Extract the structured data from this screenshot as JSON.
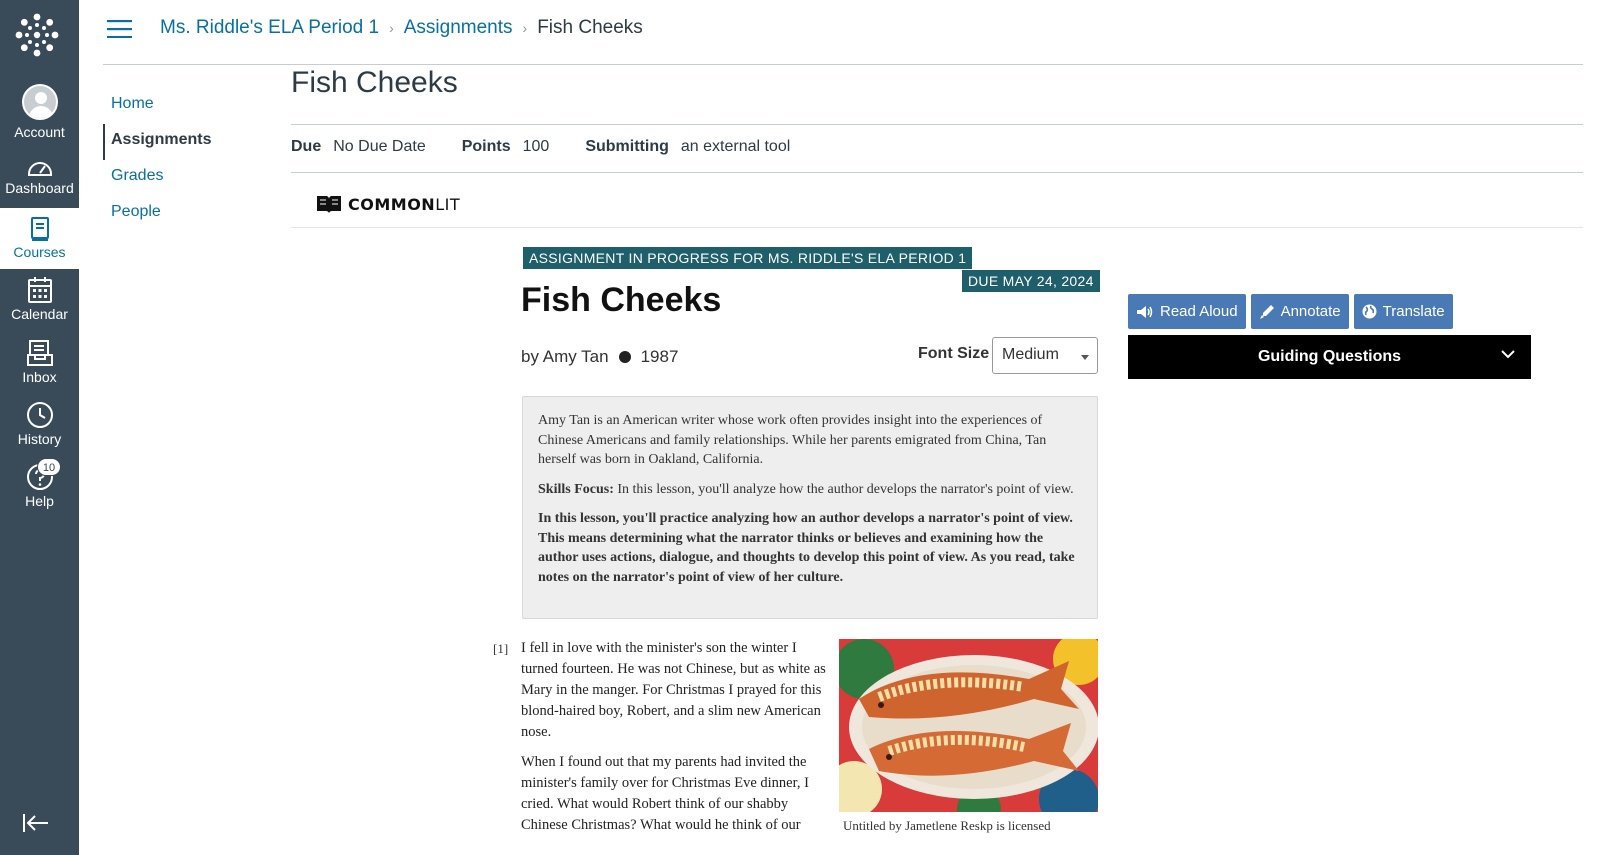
{
  "global_nav": {
    "items": [
      {
        "label": "Account",
        "icon": "account-avatar"
      },
      {
        "label": "Dashboard",
        "icon": "dashboard-icon"
      },
      {
        "label": "Courses",
        "icon": "courses-icon"
      },
      {
        "label": "Calendar",
        "icon": "calendar-icon"
      },
      {
        "label": "Inbox",
        "icon": "inbox-icon"
      },
      {
        "label": "History",
        "icon": "history-icon"
      },
      {
        "label": "Help",
        "icon": "help-icon"
      }
    ],
    "help_badge": "10"
  },
  "breadcrumb": {
    "course": "Ms. Riddle's ELA Period 1",
    "section": "Assignments",
    "current": "Fish Cheeks"
  },
  "course_nav": {
    "items": [
      "Home",
      "Assignments",
      "Grades",
      "People"
    ],
    "active": "Assignments"
  },
  "assignment": {
    "title": "Fish Cheeks",
    "due_label": "Due",
    "due_value": "No Due Date",
    "points_label": "Points",
    "points_value": "100",
    "submitting_label": "Submitting",
    "submitting_value": "an external tool"
  },
  "commonlit": {
    "logo_bold": "COMMON",
    "logo_light": "LIT",
    "status_tag": "ASSIGNMENT IN PROGRESS FOR MS. RIDDLE'S ELA PERIOD 1",
    "due_tag": "DUE MAY 24, 2024",
    "story_title": "Fish Cheeks",
    "author": "by Amy Tan",
    "year": "1987",
    "font_size_label": "Font Size",
    "font_size_value": "Medium",
    "intro_p1": "Amy Tan is an American writer whose work often provides insight into the experiences of Chinese Americans and family relationships. While her parents emigrated from China, Tan herself was born in Oakland, California.",
    "skills_label": "Skills Focus:",
    "skills_text": " In this lesson, you'll analyze how the author develops the narrator's point of view.",
    "intro_bold": "In this lesson, you'll practice analyzing how an author develops a narrator's point of view. This means determining what the narrator thinks or believes and examining how the author uses actions, dialogue, and thoughts to develop this point of view. As you read, take notes on the narrator's point of view of her culture.",
    "para_num": "[1]",
    "para1": "I fell in love with the minister's son the winter I turned fourteen. He was not Chinese, but as white as Mary in the manger. For Christmas I prayed for this blond-haired boy, Robert, and a slim new American nose.",
    "para2": "When I found out that my parents had invited the minister's family over for Christmas Eve dinner, I cried. What would Robert think of our shabby Chinese Christmas? What would he think of our",
    "caption": "Untitled by Jametlene Reskp is licensed",
    "tools": [
      "Read Aloud",
      "Annotate",
      "Translate"
    ],
    "guiding_questions": "Guiding Questions"
  }
}
